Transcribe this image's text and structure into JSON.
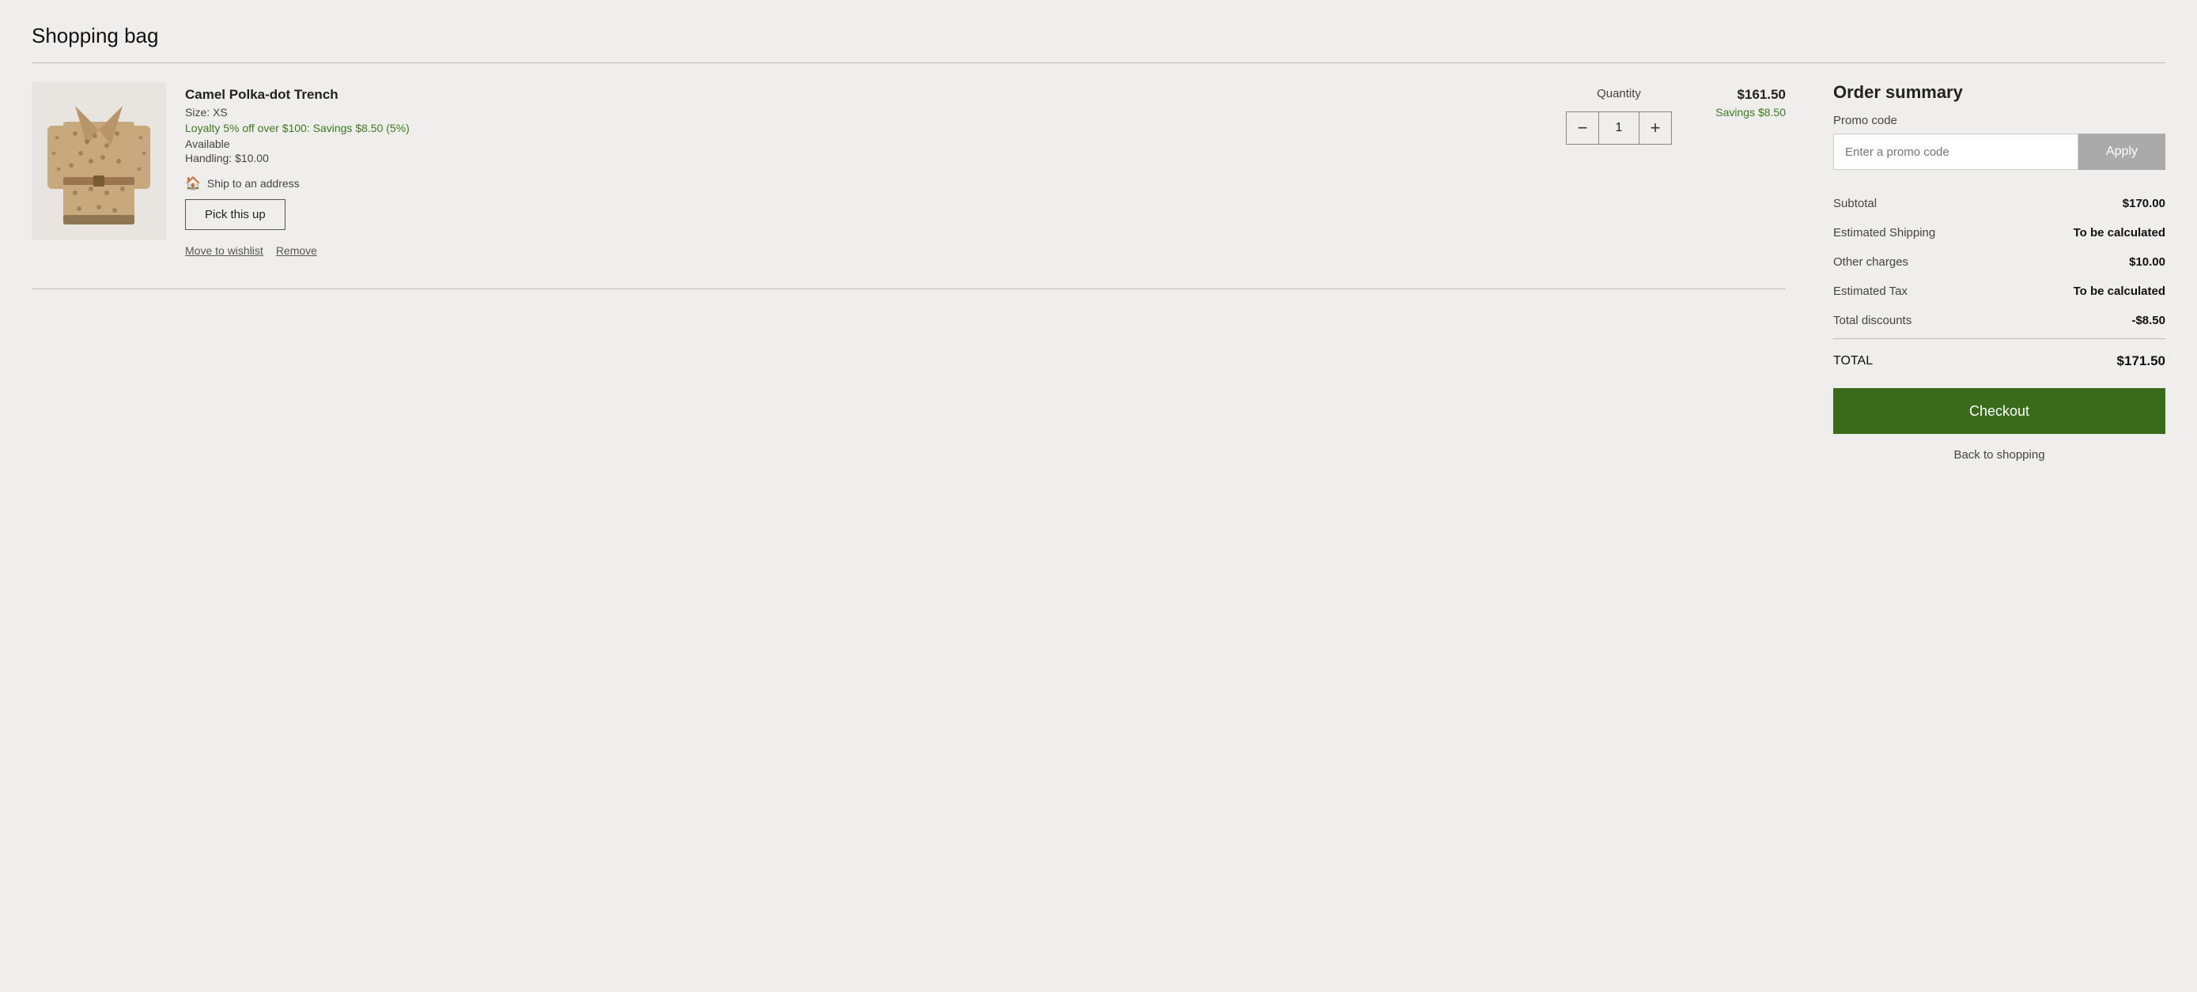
{
  "page": {
    "title": "Shopping bag"
  },
  "cart": {
    "items": [
      {
        "name": "Camel Polka-dot Trench",
        "size": "Size: XS",
        "loyalty": "Loyalty 5% off over $100: Savings $8.50 (5%)",
        "availability": "Available",
        "handling": "Handling: $10.00",
        "ship_label": "Ship to an address",
        "pick_up_label": "Pick this up",
        "quantity": "1",
        "price": "$161.50",
        "savings": "Savings $8.50",
        "move_to_wishlist": "Move to wishlist",
        "remove": "Remove"
      }
    ],
    "quantity_label": "Quantity",
    "minus_label": "−",
    "plus_label": "+"
  },
  "order_summary": {
    "title": "Order summary",
    "promo_label": "Promo code",
    "promo_placeholder": "Enter a promo code",
    "apply_label": "Apply",
    "rows": [
      {
        "label": "Subtotal",
        "value": "$170.00",
        "bold": true
      },
      {
        "label": "Estimated Shipping",
        "value": "To be calculated",
        "bold": true
      },
      {
        "label": "Other charges",
        "value": "$10.00",
        "bold": true
      },
      {
        "label": "Estimated Tax",
        "value": "To be calculated",
        "bold": true
      },
      {
        "label": "Total discounts",
        "value": "-$8.50",
        "bold": true
      }
    ],
    "total_label": "TOTAL",
    "total_value": "$171.50",
    "checkout_label": "Checkout",
    "back_label": "Back to shopping"
  }
}
